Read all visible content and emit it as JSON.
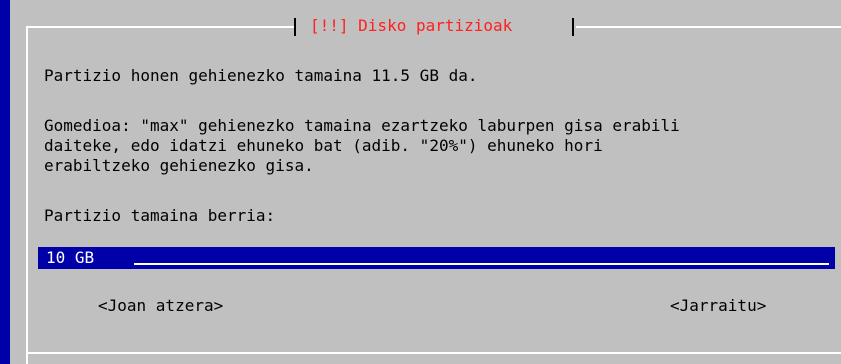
{
  "dialog": {
    "title": "[!!] Disko partizioak",
    "max_size_message": "Partizio honen gehienezko tamaina 11.5 GB da.",
    "hint_lines": [
      "Gomedioa: \"max\" gehienezko tamaina ezartzeko laburpen gisa erabili",
      "daiteke, edo idatzi ehuneko bat (adib. \"20%\") ehuneko hori",
      "erabiltzeko gehienezko gisa."
    ],
    "new_size_label": "Partizio tamaina berria:",
    "size_input": {
      "value": "10 GB"
    },
    "buttons": {
      "back_label": "<Joan atzera>",
      "continue_label": "<Jarraitu>"
    }
  },
  "colors": {
    "background": "#0000a8",
    "dialog_background": "#c0c0c0",
    "title_text": "#ff2020",
    "frame": "#ffffff",
    "input_background": "#0000a8",
    "input_text": "#ffffff"
  }
}
